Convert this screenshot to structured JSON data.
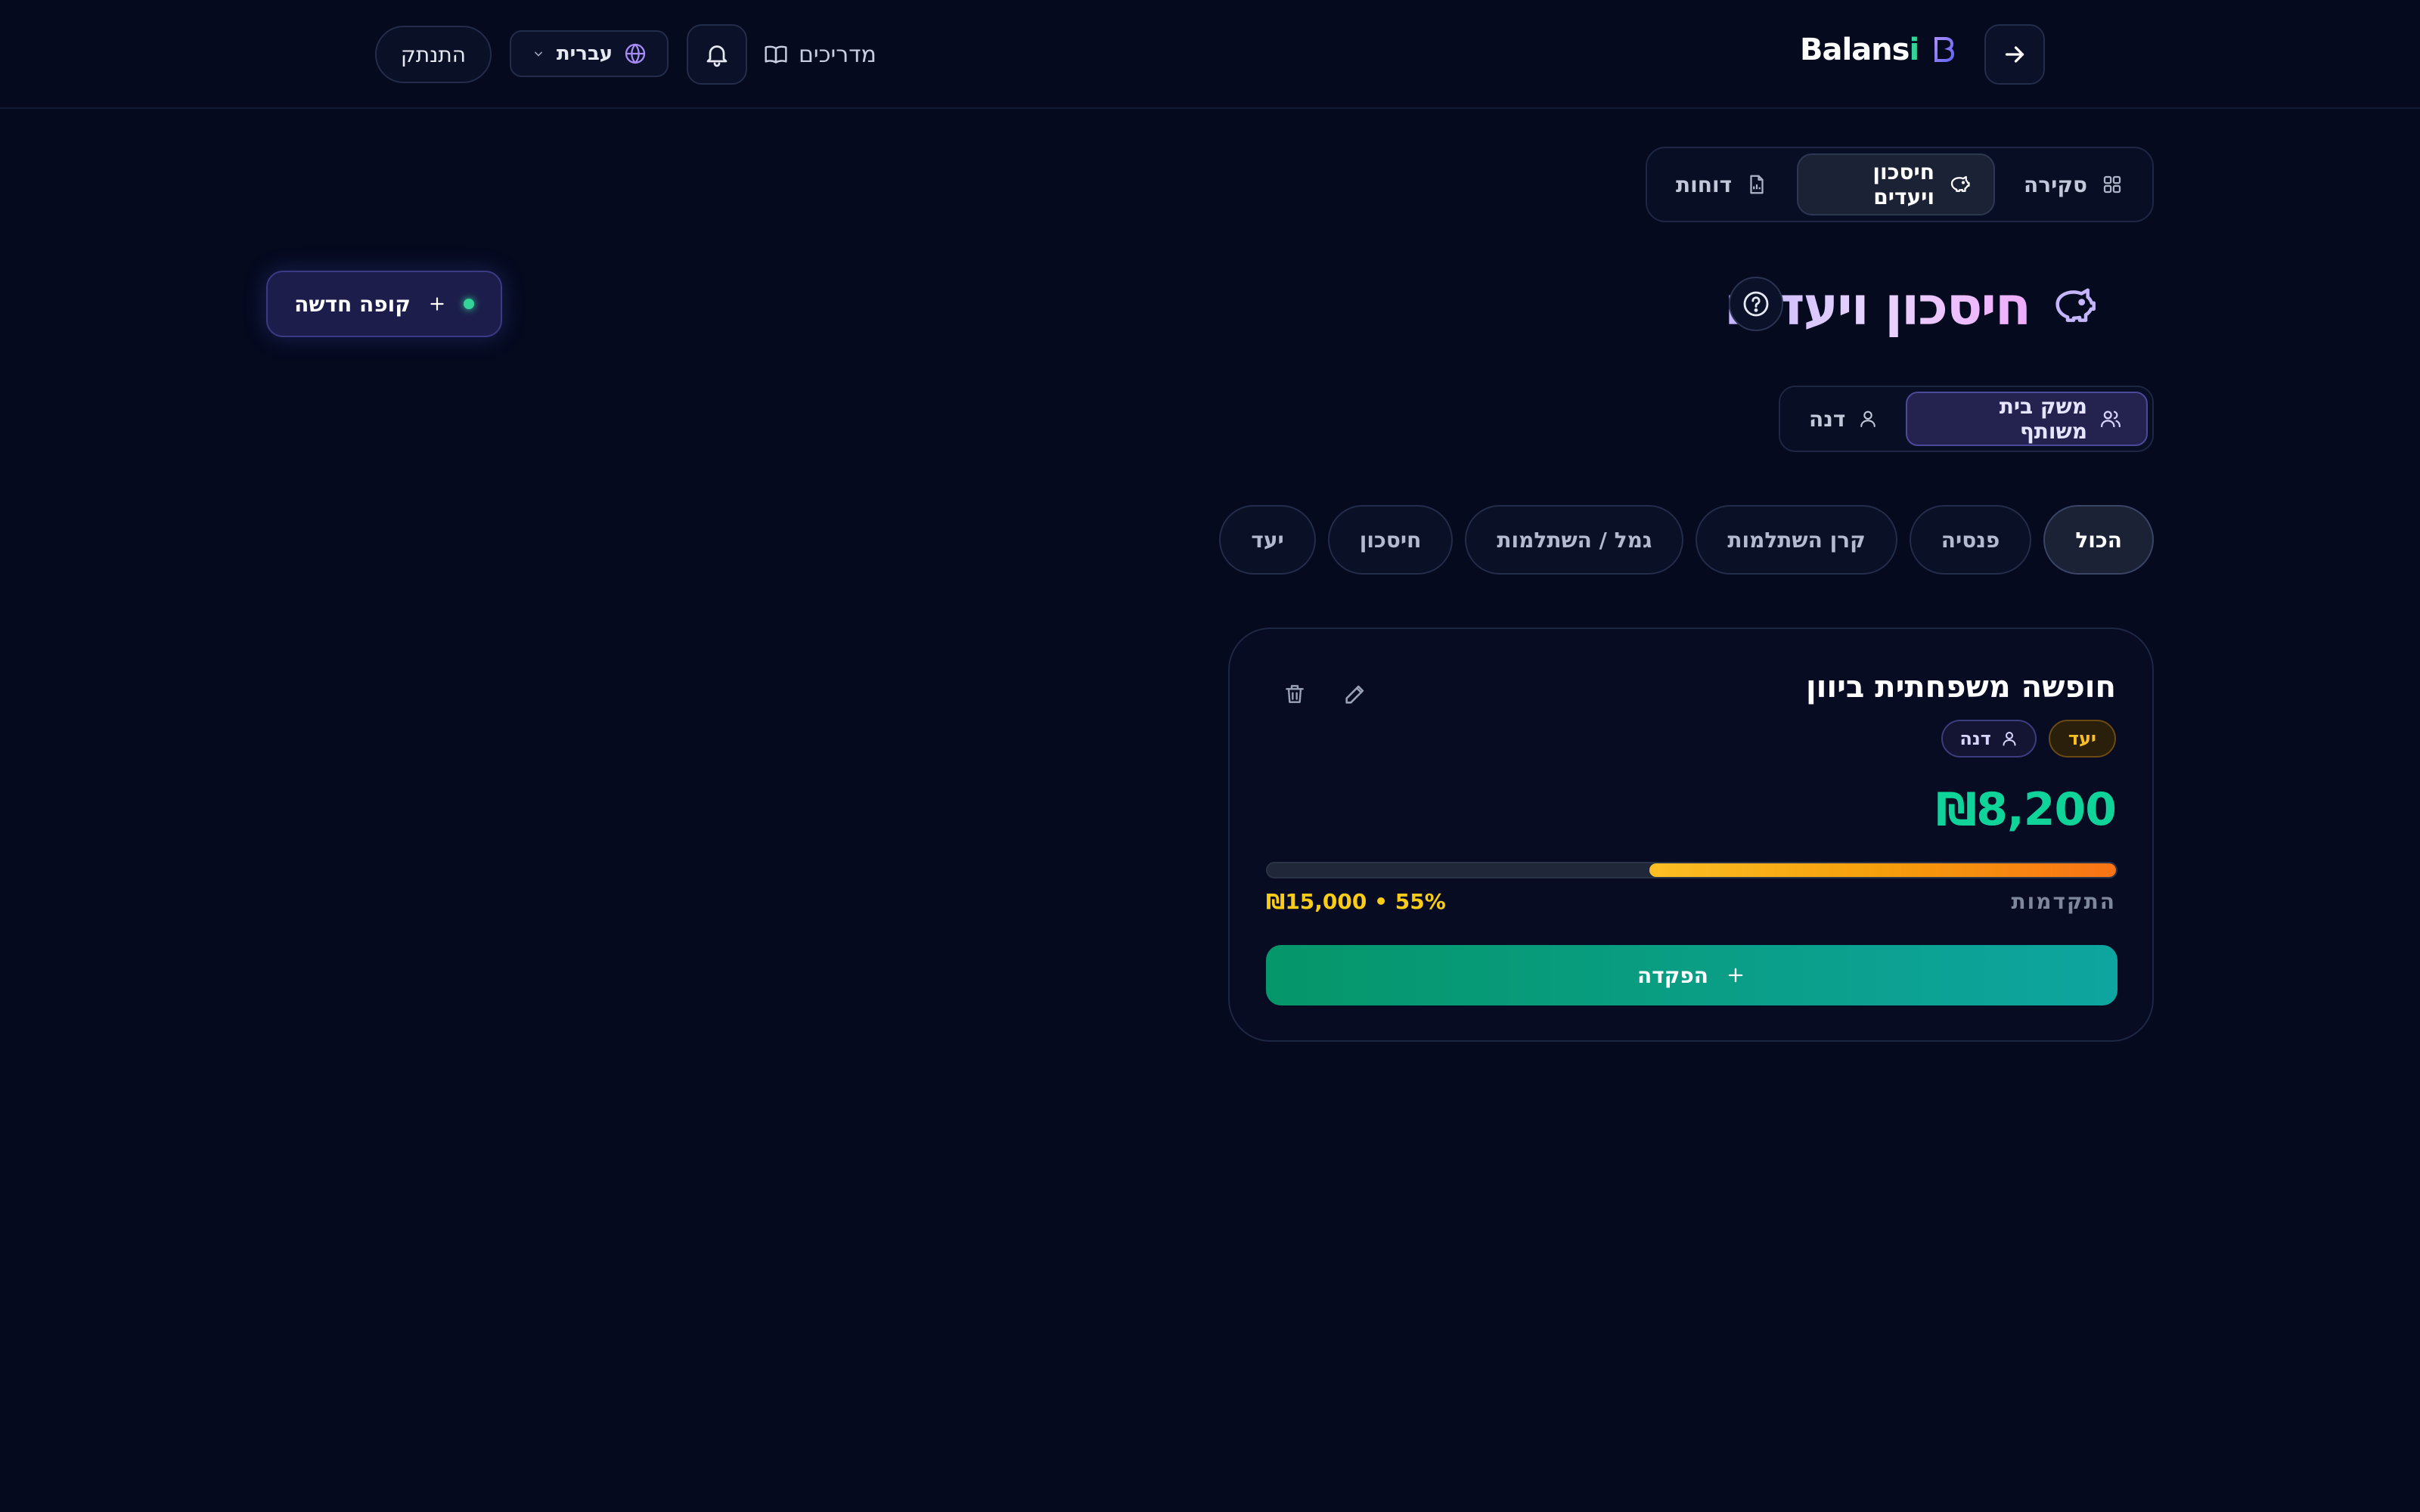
{
  "header": {
    "brand_text_main": "Balans",
    "brand_text_accent": "i",
    "guides_label": "מדריכים",
    "language_label": "עברית",
    "logout_label": "התנתק"
  },
  "nav": {
    "tabs": [
      {
        "label": "סקירה",
        "icon": "grid-icon",
        "active": false
      },
      {
        "label": "חיסכון ויעדים",
        "icon": "piggy-bank-icon",
        "active": true
      },
      {
        "label": "דוחות",
        "icon": "report-file-icon",
        "active": false
      }
    ]
  },
  "page": {
    "title": "חיסכון ויעדים",
    "new_fund_label": "קופה חדשה"
  },
  "owner_filter": {
    "options": [
      {
        "label": "משק בית משותף",
        "icon": "users-icon",
        "active": true
      },
      {
        "label": "דנה",
        "icon": "user-icon",
        "active": false
      }
    ]
  },
  "categories": {
    "items": [
      {
        "label": "הכול",
        "active": true
      },
      {
        "label": "פנסיה",
        "active": false
      },
      {
        "label": "קרן השתלמות",
        "active": false
      },
      {
        "label": "גמל / השתלמות",
        "active": false
      },
      {
        "label": "חיסכון",
        "active": false
      },
      {
        "label": "יעד",
        "active": false
      }
    ]
  },
  "fund_card": {
    "title": "חופשה משפחתית ביוון",
    "type_badge": "יעד",
    "owner_badge": "דנה",
    "amount": "₪8,200",
    "progress_label": "התקדמות",
    "progress_value": "₪15,000 • 55%",
    "progress_percent": 55,
    "deposit_label": "הפקדה"
  },
  "colors": {
    "background": "#050a1f",
    "accent_green": "#10d39a",
    "accent_purple": "#c4b5fd",
    "progress_orange": "#f59e0b"
  }
}
